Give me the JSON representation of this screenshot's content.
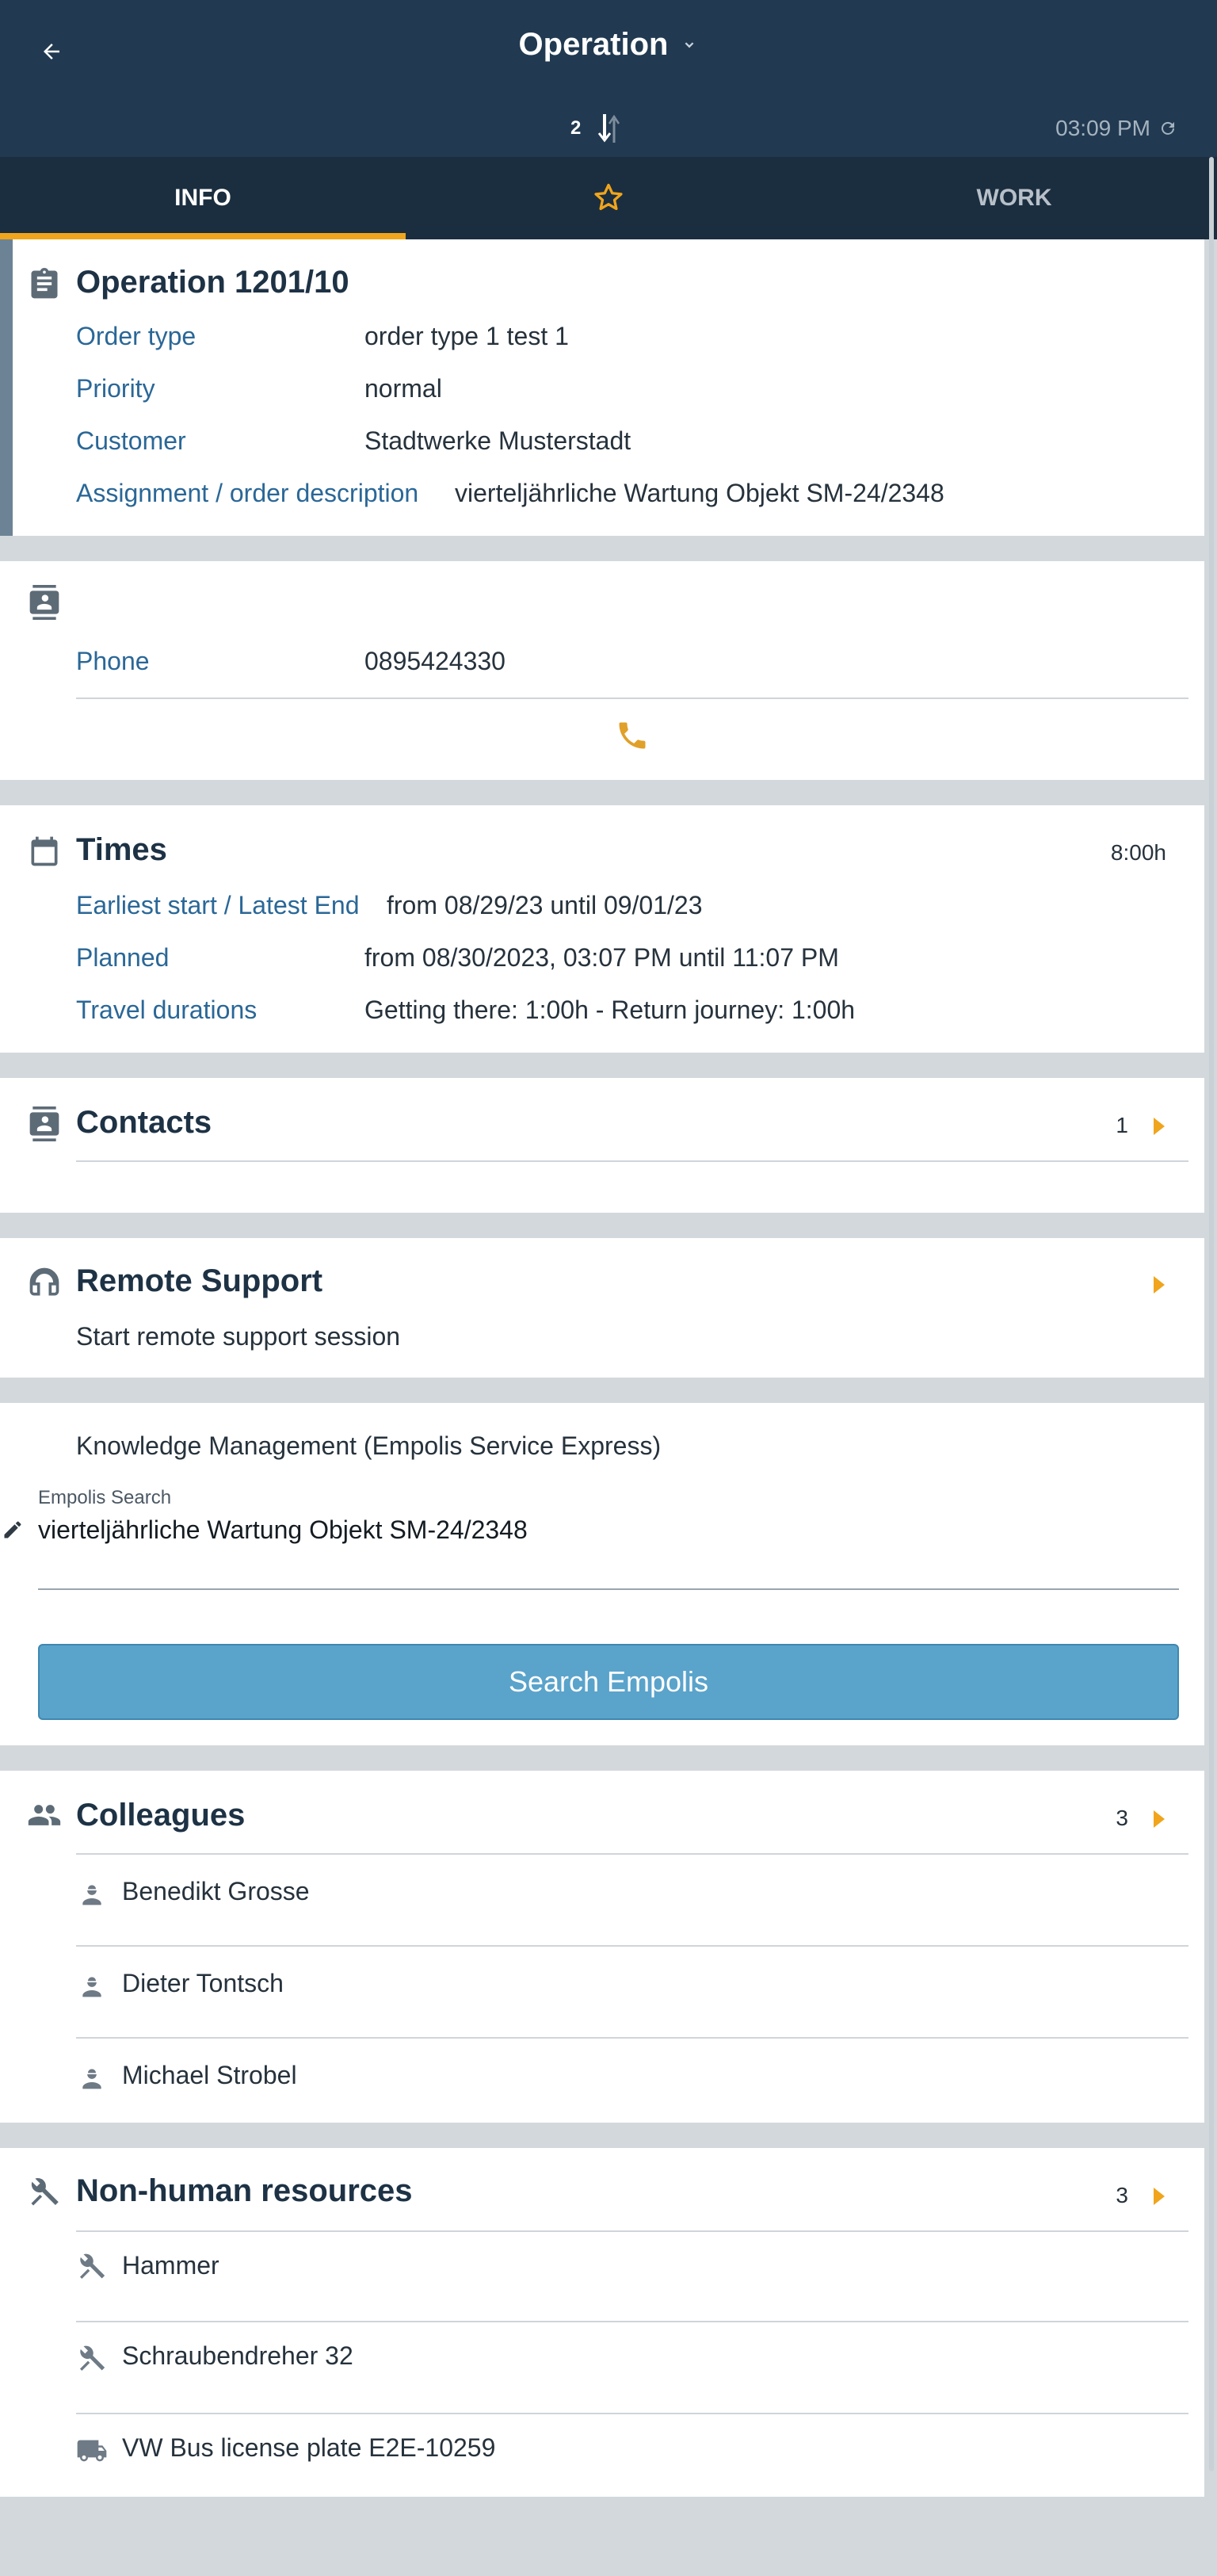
{
  "header": {
    "title": "Operation",
    "pending_sync_count": "2",
    "clock": "03:09 PM"
  },
  "tabs": [
    {
      "label": "INFO"
    },
    {
      "label": ""
    },
    {
      "label": "WORK"
    }
  ],
  "operation": {
    "title": "Operation 1201/10",
    "fields": [
      {
        "label": "Order type",
        "value": "order type 1 test 1"
      },
      {
        "label": "Priority",
        "value": "normal"
      },
      {
        "label": "Customer",
        "value": "Stadtwerke Musterstadt"
      },
      {
        "label": "Assignment / order description",
        "value": "vierteljährliche Wartung Objekt SM-24/2348"
      }
    ]
  },
  "contact_card": {
    "phone_label": "Phone",
    "phone_value": "0895424330"
  },
  "times": {
    "title": "Times",
    "duration": "8:00h",
    "fields": [
      {
        "label": "Earliest start / Latest End",
        "value": "from 08/29/23 until 09/01/23"
      },
      {
        "label": "Planned",
        "value": "from 08/30/2023, 03:07 PM until 11:07 PM"
      },
      {
        "label": "Travel durations",
        "value": "Getting there: 1:00h - Return journey: 1:00h"
      }
    ]
  },
  "contacts": {
    "title": "Contacts",
    "count": "1"
  },
  "remote_support": {
    "title": "Remote Support",
    "subtitle": "Start remote support session"
  },
  "knowledge": {
    "title": "Knowledge Management (Empolis Service Express)",
    "search_label": "Empolis Search",
    "search_value": "vierteljährliche Wartung Objekt SM-24/2348",
    "button_label": "Search Empolis"
  },
  "colleagues": {
    "title": "Colleagues",
    "count": "3",
    "items": [
      {
        "name": "Benedikt Grosse"
      },
      {
        "name": "Dieter Tontsch"
      },
      {
        "name": "Michael Strobel"
      }
    ]
  },
  "resources": {
    "title": "Non-human resources",
    "count": "3",
    "items": [
      {
        "name": "Hammer",
        "icon": "tools-icon"
      },
      {
        "name": "Schraubendreher 32",
        "icon": "tools-icon"
      },
      {
        "name": "VW Bus license plate E2E-10259",
        "icon": "truck-icon"
      }
    ]
  },
  "colors": {
    "header": "#213a51",
    "tabs": "#1b2e3f",
    "accent": "#f0a51c",
    "label_blue": "#2a6797",
    "button": "#5aa3cb"
  }
}
